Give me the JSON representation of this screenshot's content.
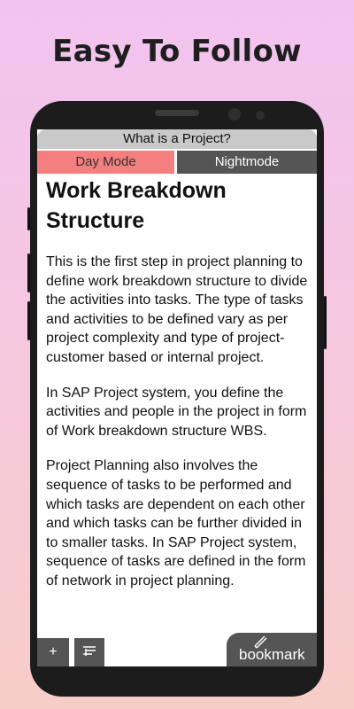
{
  "headline": "Easy To Follow",
  "app": {
    "title": "What is a Project?",
    "day_mode_label": "Day Mode",
    "night_mode_label": "Nightmode"
  },
  "article": {
    "heading": "Work Breakdown Structure",
    "paragraphs": [
      "This is the first step in project planning to define work breakdown structure to divide the activities into tasks. The type of tasks and activities to be defined vary as per project complexity and type of project- customer based or internal project.",
      "In SAP Project system, you define the activities and people in the project in form of Work breakdown structure WBS.",
      "Project Planning also involves the sequence of tasks to be performed and which tasks are dependent on each other and which tasks can be further divided in to smaller tasks. In SAP Project system, sequence of tasks are defined in the form of network in project planning."
    ]
  },
  "bottom_bar": {
    "plus_label": "+",
    "bookmark_label": "bookmark"
  },
  "icons": {
    "list": "list-icon",
    "edit": "pencil-icon"
  },
  "colors": {
    "day_mode": "#f57f7f",
    "night_mode": "#555555",
    "title_bar": "#c9c9c9"
  }
}
